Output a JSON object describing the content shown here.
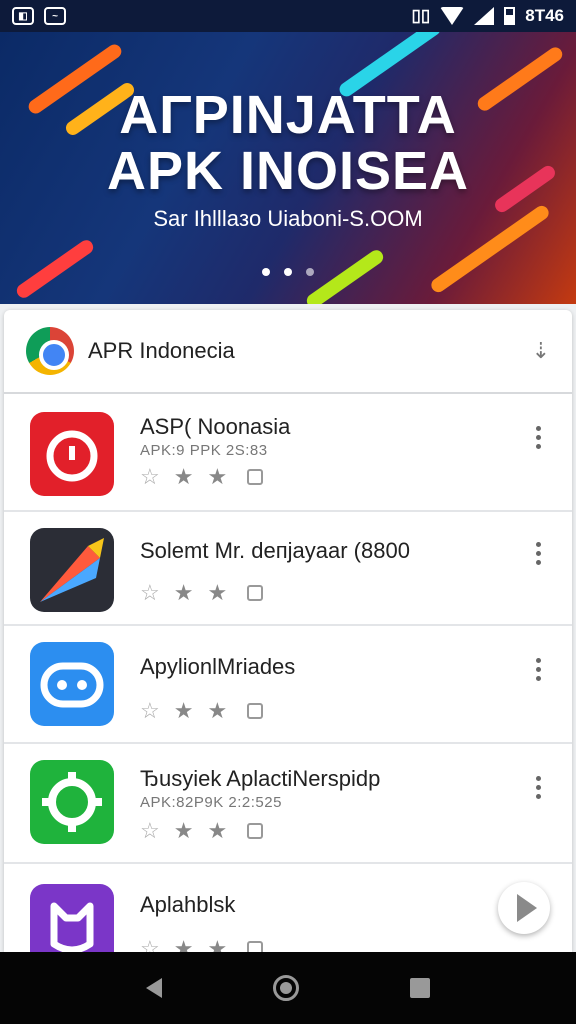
{
  "status_bar": {
    "left_icons": [
      "notification-icon",
      "message-icon"
    ],
    "time": "8T46",
    "icons": [
      "vibrate-icon",
      "wifi-icon",
      "signal-icon",
      "battery-icon"
    ]
  },
  "banner": {
    "title_line1": "AΓPINJATTA",
    "title_line2": "APK INOISEA",
    "subtitle": "Sar Ihlllaзo Uiaboni-S.OOM",
    "page_count": 3,
    "active_page": 0
  },
  "list_header": {
    "title": "APR Indonecia",
    "icon": "chrome-icon",
    "action_icon": "download-arrow-icon"
  },
  "apps": [
    {
      "name": "ASP( Noonasia",
      "meta": "APK:9 PPK  2S:83",
      "icon": "timer-app-icon",
      "icon_color": "#e2202a",
      "stars_filled": 2
    },
    {
      "name": "Solemt Mr. deпjayaar (8800",
      "meta": "",
      "icon": "pen-app-icon",
      "icon_color": "#2b2d36",
      "stars_filled": 2
    },
    {
      "name": "ApylionlMriades",
      "meta": "",
      "icon": "chat-app-icon",
      "icon_color": "#2c8ef0",
      "stars_filled": 2
    },
    {
      "name": "Ђusyiek AplactiNerspidp",
      "meta": "APK:82P9K  2:2:525",
      "icon": "ring-app-icon",
      "icon_color": "#1fb33c",
      "stars_filled": 2
    },
    {
      "name": "Aplahblsk",
      "meta": "",
      "icon": "face-app-icon",
      "icon_color": "#7b36c8",
      "stars_filled": 2
    }
  ],
  "fab": {
    "icon": "play-arrow-icon"
  },
  "nav": {
    "back": "back-icon",
    "home": "home-icon",
    "recent": "recent-apps-icon"
  },
  "colors": {
    "banner_dark": "#0b2a66",
    "banner_warm": "#c43a10",
    "nav_bg": "#050505"
  }
}
